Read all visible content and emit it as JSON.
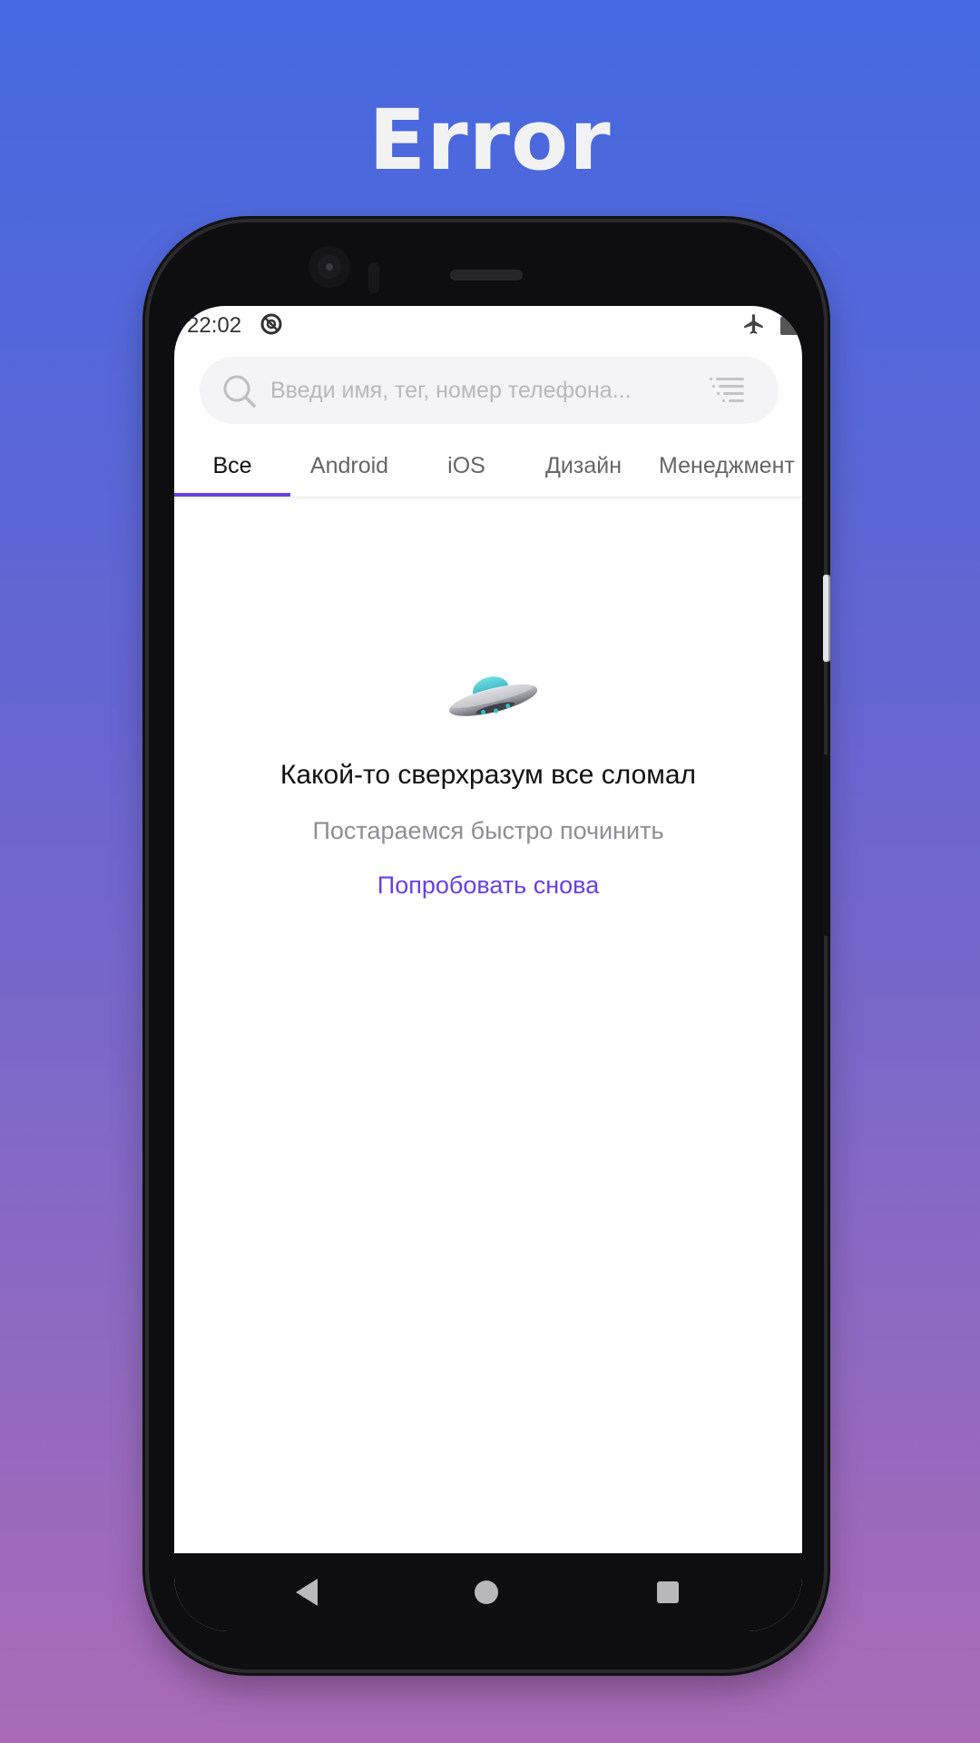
{
  "promo": {
    "title": "Error"
  },
  "status_bar": {
    "time": "22:02",
    "icons": [
      "sync-icon",
      "airplane-icon",
      "battery-icon"
    ]
  },
  "search": {
    "placeholder": "Введи имя, тег, номер телефона...",
    "value": ""
  },
  "tabs": [
    {
      "label": "Все",
      "active": true
    },
    {
      "label": "Android",
      "active": false
    },
    {
      "label": "iOS",
      "active": false
    },
    {
      "label": "Дизайн",
      "active": false
    },
    {
      "label": "Менеджмент",
      "active": false
    }
  ],
  "error_state": {
    "icon": "ufo-icon",
    "title": "Какой-то сверхразум все сломал",
    "subtitle": "Постараемся быстро починить",
    "retry_label": "Попробовать снова"
  },
  "colors": {
    "accent": "#6a3fe5",
    "background_top": "#4469e0",
    "background_bottom": "#ab6ab6"
  }
}
